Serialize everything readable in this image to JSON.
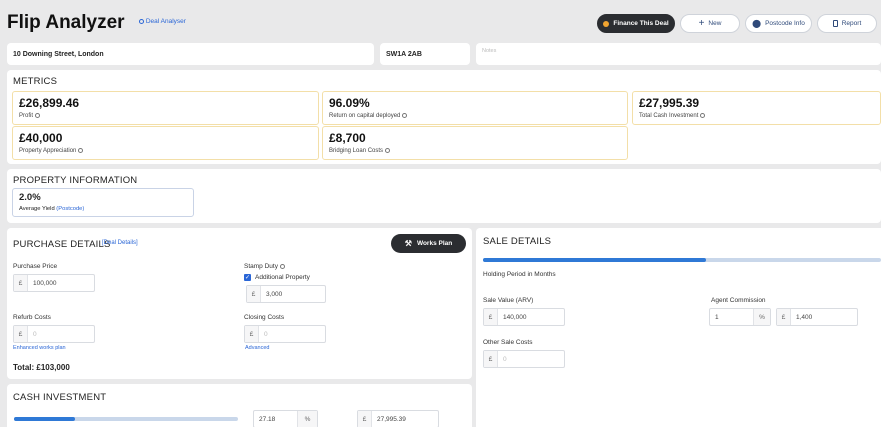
{
  "header": {
    "title": "Flip Analyzer",
    "subtitle_link": "Deal Analyser",
    "buttons": {
      "finance": "Finance This Deal",
      "new": "New",
      "postcode": "Postcode Info",
      "report": "Report"
    }
  },
  "address": {
    "street": "10 Downing Street, London",
    "postcode": "SW1A 2AB",
    "notes_placeholder": "Notes"
  },
  "metrics": {
    "title": "METRICS",
    "items": [
      {
        "value": "£26,899.46",
        "label": "Profit"
      },
      {
        "value": "96.09%",
        "label": "Return on capital deployed"
      },
      {
        "value": "£27,995.39",
        "label": "Total Cash Investment"
      },
      {
        "value": "£40,000",
        "label": "Property Appreciation"
      },
      {
        "value": "£8,700",
        "label": "Bridging Loan Costs"
      }
    ]
  },
  "property_info": {
    "title": "PROPERTY INFORMATION",
    "yield_value": "2.0%",
    "yield_label": "Average Yield",
    "yield_link": "(Postcode)"
  },
  "purchase": {
    "title": "PURCHASE DETAILS",
    "deal_link": "[Deal Details]",
    "works_button": "Works Plan",
    "currency": "£",
    "purchase_price_label": "Purchase Price",
    "purchase_price_value": "100,000",
    "stamp_duty_label": "Stamp Duty",
    "additional_property_label": "Additional Property",
    "additional_property_checked": true,
    "stamp_duty_value": "3,000",
    "refurb_label": "Refurb Costs",
    "refurb_placeholder": "0",
    "enhanced_link": "Enhanced works plan",
    "closing_label": "Closing Costs",
    "closing_placeholder": "0",
    "advanced_link": "Advanced",
    "total": "Total: £103,000"
  },
  "sale": {
    "title": "SALE DETAILS",
    "holding_label": "Holding Period in Months",
    "holding_level": 0.56,
    "currency": "£",
    "sale_value_label": "Sale Value (ARV)",
    "sale_value": "140,000",
    "agent_label": "Agent Commission",
    "agent_percent": "1",
    "percent_symbol": "%",
    "agent_amount": "1,400",
    "other_label": "Other Sale Costs",
    "other_placeholder": "0"
  },
  "cash": {
    "title": "CASH INVESTMENT",
    "level": 0.2718,
    "percent_value": "27.18",
    "percent_symbol": "%",
    "currency": "£",
    "amount": "27,995.39"
  }
}
